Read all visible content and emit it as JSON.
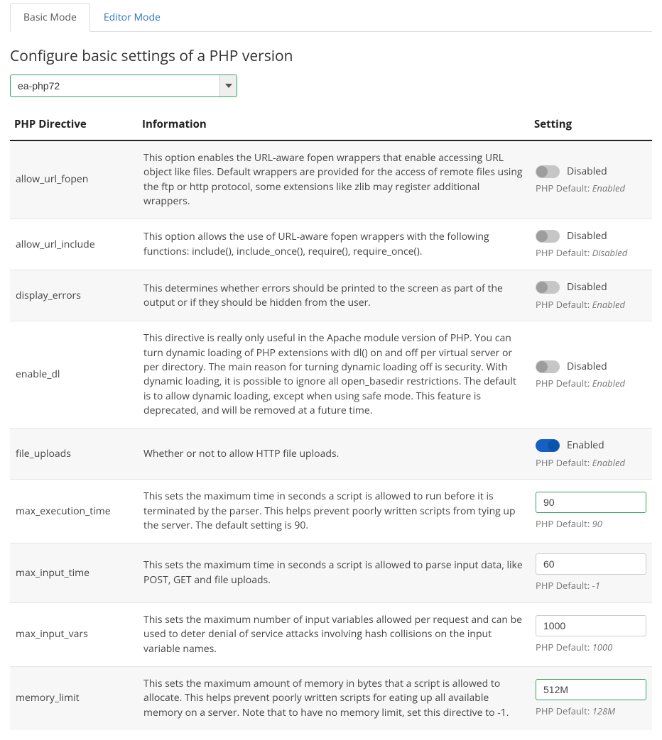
{
  "tabs": {
    "basic": "Basic Mode",
    "editor": "Editor Mode"
  },
  "section_title": "Configure basic settings of a PHP version",
  "version_select": {
    "selected": "ea-php72"
  },
  "headers": {
    "directive": "PHP Directive",
    "info": "Information",
    "setting": "Setting"
  },
  "labels": {
    "enabled": "Enabled",
    "disabled": "Disabled",
    "default_prefix": "PHP Default: "
  },
  "rows": [
    {
      "name": "allow_url_fopen",
      "info": "This option enables the URL-aware fopen wrappers that enable accessing URL object like files. Default wrappers are provided for the access of remote files using the ftp or http protocol, some extensions like zlib may register additional wrappers.",
      "type": "toggle",
      "enabled": false,
      "default": "Enabled",
      "striped": true
    },
    {
      "name": "allow_url_include",
      "info": "This option allows the use of URL-aware fopen wrappers with the following functions: include(), include_once(), require(), require_once().",
      "type": "toggle",
      "enabled": false,
      "default": "Disabled",
      "striped": false
    },
    {
      "name": "display_errors",
      "info": "This determines whether errors should be printed to the screen as part of the output or if they should be hidden from the user.",
      "type": "toggle",
      "enabled": false,
      "default": "Enabled",
      "striped": true
    },
    {
      "name": "enable_dl",
      "info": "This directive is really only useful in the Apache module version of PHP. You can turn dynamic loading of PHP extensions with dl() on and off per virtual server or per directory. The main reason for turning dynamic loading off is security. With dynamic loading, it is possible to ignore all open_basedir restrictions. The default is to allow dynamic loading, except when using safe mode. This feature is deprecated, and will be removed at a future time.",
      "type": "toggle",
      "enabled": false,
      "default": "Enabled",
      "striped": false
    },
    {
      "name": "file_uploads",
      "info": "Whether or not to allow HTTP file uploads.",
      "type": "toggle",
      "enabled": true,
      "default": "Enabled",
      "striped": true
    },
    {
      "name": "max_execution_time",
      "info": "This sets the maximum time in seconds a script is allowed to run before it is terminated by the parser. This helps prevent poorly written scripts from tying up the server. The default setting is 90.",
      "type": "input",
      "value": "90",
      "default": "90",
      "green": true,
      "striped": false
    },
    {
      "name": "max_input_time",
      "info": "This sets the maximum time in seconds a script is allowed to parse input data, like POST, GET and file uploads.",
      "type": "input",
      "value": "60",
      "default": "-1",
      "green": false,
      "striped": true
    },
    {
      "name": "max_input_vars",
      "info": "This sets the maximum number of input variables allowed per request and can be used to deter denial of service attacks involving hash collisions on the input variable names.",
      "type": "input",
      "value": "1000",
      "default": "1000",
      "green": false,
      "striped": false
    },
    {
      "name": "memory_limit",
      "info": "This sets the maximum amount of memory in bytes that a script is allowed to allocate. This helps prevent poorly written scripts for eating up all available memory on a server. Note that to have no memory limit, set this directive to -1.",
      "type": "input",
      "value": "512M",
      "default": "128M",
      "green": true,
      "striped": true
    }
  ]
}
